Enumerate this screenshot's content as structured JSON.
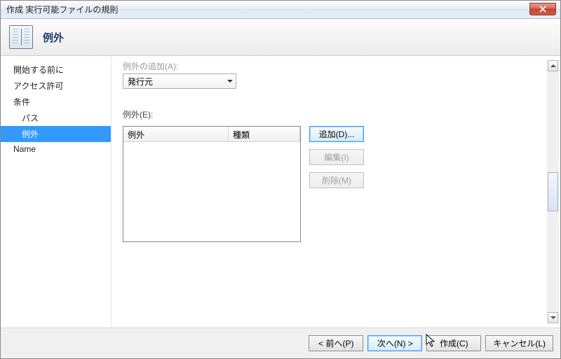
{
  "window": {
    "title": "作成 実行可能ファイルの規則"
  },
  "header": {
    "title": "例外"
  },
  "sidebar": {
    "items": [
      {
        "label": "開始する前に",
        "sub": false,
        "selected": false
      },
      {
        "label": "アクセス許可",
        "sub": false,
        "selected": false
      },
      {
        "label": "条件",
        "sub": false,
        "selected": false
      },
      {
        "label": "パス",
        "sub": true,
        "selected": false
      },
      {
        "label": "例外",
        "sub": true,
        "selected": true
      },
      {
        "label": "Name",
        "sub": false,
        "selected": false
      }
    ]
  },
  "content": {
    "addLabel": "例外の追加(A):",
    "combo": {
      "value": "発行元"
    },
    "listLabel": "例外(E):",
    "table": {
      "col1": "例外",
      "col2": "種類"
    },
    "buttons": {
      "add": "追加(D)...",
      "edit": "編集(I)",
      "remove": "削除(M)"
    }
  },
  "footer": {
    "back": "< 前へ(P)",
    "next": "次へ(N) >",
    "create": "作成(C)",
    "cancel": "キャンセル(L)"
  }
}
